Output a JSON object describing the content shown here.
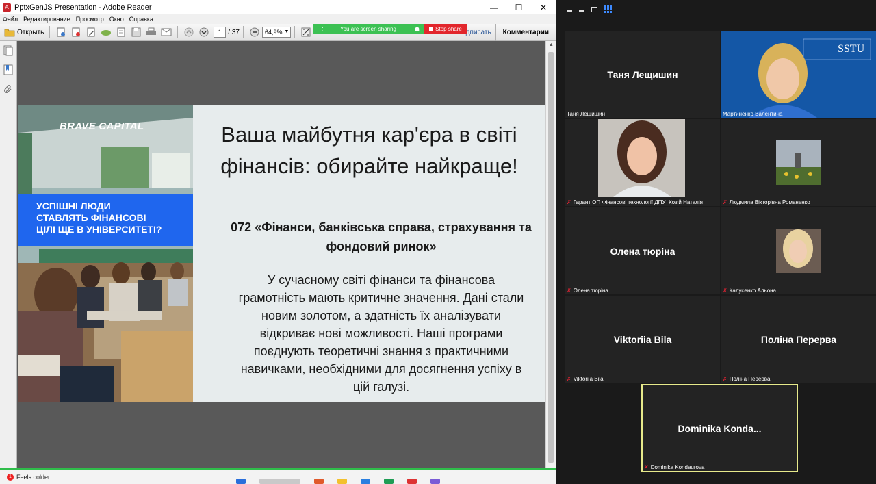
{
  "reader": {
    "title": "PptxGenJS Presentation - Adobe Reader",
    "menu": [
      "Файл",
      "Редактирование",
      "Просмотр",
      "Окно",
      "Справка"
    ],
    "toolbar": {
      "open_label": "Открыть",
      "page_current": "1",
      "page_total": "/ 37",
      "zoom_value": "64,9%",
      "sign_label": "дписать",
      "comments_label": "Комментарии"
    },
    "share": {
      "status": "You are screen sharing",
      "stop_label": "Stop share"
    },
    "slide": {
      "brand_bold": "BRAVE",
      "brand_rest": "CAPITAL",
      "slogan": [
        "УСПІШНІ ЛЮДИ",
        "СТАВЛЯТЬ ФІНАНСОВІ",
        "ЦІЛІ ЩЕ В УНІВЕРСИТЕТІ?"
      ],
      "title_lines": [
        "Ваша майбутня кар'єра в світі",
        "фінансів: обирайте найкраще!"
      ],
      "subtitle_lines": [
        "072 «Фінанси, банківська справа, страхування та",
        "фондовий ринок»"
      ],
      "body_lines": [
        "У сучасному світі фінанси та фінансова",
        "грамотність мають критичне значення. Дані стали",
        "новим золотом, а здатність їх аналізувати",
        "відкриває нові можливості. Наші програми",
        "поєднують теоретичні знання з практичними",
        "навичками, необхідними для досягнення успіху в",
        "цій галузі."
      ]
    },
    "taskbar": {
      "weather_text": "Feels colder",
      "badge": "1"
    }
  },
  "zoom": {
    "participants": [
      {
        "center": "Таня Лещишин",
        "tag": "Таня Лещишин",
        "muted": false
      },
      {
        "center": "",
        "tag": "Мартиненко Валентина",
        "muted": false,
        "logo": "SSTU"
      },
      {
        "center": "",
        "tag": "Гарант ОП Фінансові технології ДПУ_Козій Наталія",
        "muted": true
      },
      {
        "center": "",
        "tag": "Людмила Вікторівна Романенко",
        "muted": true
      },
      {
        "center": "Олена тюріна",
        "tag": "Олена тюріна",
        "muted": true
      },
      {
        "center": "",
        "tag": "Калусенко Альона",
        "muted": true
      },
      {
        "center": "Viktoriia Bila",
        "tag": "Viktoriia Bila",
        "muted": true
      },
      {
        "center": "Поліна Перерва",
        "tag": "Поліна Перерва",
        "muted": true
      },
      {
        "center": "Dominika  Konda...",
        "tag": "Dominika Kondaurova",
        "muted": true
      }
    ]
  },
  "colors": {
    "share_green": "#3cc153",
    "share_red": "#e2262c",
    "slogan_blue": "#1f66ee",
    "active_border": "#e6e98b"
  }
}
